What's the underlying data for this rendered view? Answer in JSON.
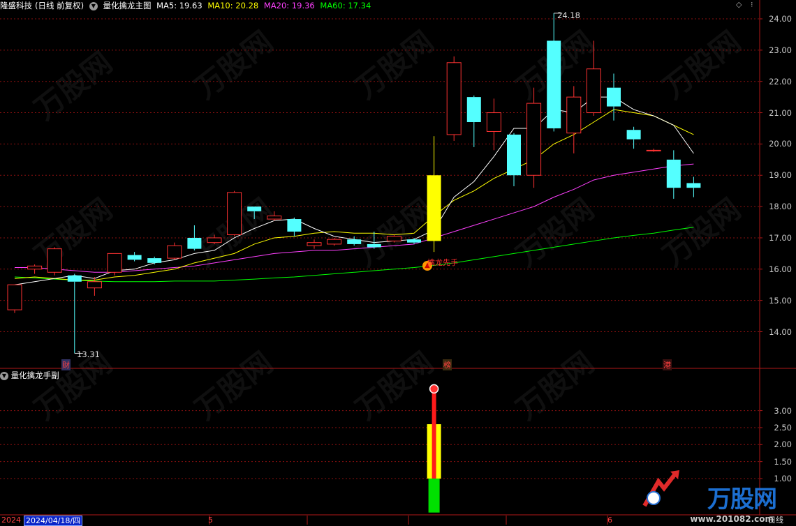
{
  "title_bar": {
    "stock_name": "隆盛科技",
    "period": "(日线 前复权)",
    "indicator_name": "量化擒龙主图",
    "ma5": "MA5: 19.63",
    "ma10": "MA10: 20.28",
    "ma20": "MA20: 19.36",
    "ma60": "MA60: 17.34",
    "colors": {
      "ma5": "#ffffff",
      "ma10": "#ffff00",
      "ma20": "#ff40ff",
      "ma60": "#00ff00"
    }
  },
  "sub_panel": {
    "title": "量化擒龙手副"
  },
  "main_axis": {
    "labels": [
      "24.00",
      "23.00",
      "22.00",
      "21.00",
      "20.00",
      "19.00",
      "18.00",
      "17.00",
      "16.00",
      "15.00",
      "14.00"
    ]
  },
  "sub_axis": {
    "labels": [
      "3.00",
      "2.50",
      "2.00",
      "1.50",
      "1.00"
    ]
  },
  "annotations": {
    "high": "24.18",
    "low": "13.31",
    "signal": "擒龙先手",
    "mark_cai": "财",
    "mark_bang": "榜",
    "mark_gang": "港"
  },
  "date_bar": {
    "start": "2024",
    "selected_date": "2024/04/18/四",
    "month5": "5",
    "month6": "6",
    "period_label": "日线"
  },
  "watermark": {
    "text": "万股网",
    "url": "www.201082.com"
  },
  "logo": {
    "text": "万股网",
    "url": "www.201082.com"
  },
  "chart_data": {
    "type": "candlestick",
    "ylim": [
      13.0,
      24.5
    ],
    "candles": [
      {
        "o": 14.7,
        "h": 15.5,
        "l": 14.6,
        "c": 15.5
      },
      {
        "o": 16.0,
        "h": 16.15,
        "l": 15.85,
        "c": 16.1
      },
      {
        "o": 15.9,
        "h": 16.7,
        "l": 15.8,
        "c": 16.65
      },
      {
        "o": 15.8,
        "h": 15.85,
        "l": 13.31,
        "c": 15.6
      },
      {
        "o": 15.4,
        "h": 15.75,
        "l": 15.15,
        "c": 15.6
      },
      {
        "o": 15.9,
        "h": 16.5,
        "l": 15.8,
        "c": 16.5
      },
      {
        "o": 16.45,
        "h": 16.55,
        "l": 16.25,
        "c": 16.3
      },
      {
        "o": 16.35,
        "h": 16.4,
        "l": 16.15,
        "c": 16.2
      },
      {
        "o": 16.35,
        "h": 16.85,
        "l": 16.3,
        "c": 16.75
      },
      {
        "o": 17.0,
        "h": 17.4,
        "l": 16.6,
        "c": 16.65
      },
      {
        "o": 16.85,
        "h": 17.1,
        "l": 16.8,
        "c": 17.0
      },
      {
        "o": 17.1,
        "h": 18.5,
        "l": 17.05,
        "c": 18.45
      },
      {
        "o": 18.0,
        "h": 18.0,
        "l": 17.6,
        "c": 17.85
      },
      {
        "o": 17.6,
        "h": 17.85,
        "l": 17.55,
        "c": 17.7
      },
      {
        "o": 17.6,
        "h": 17.65,
        "l": 17.05,
        "c": 17.2
      },
      {
        "o": 16.75,
        "h": 16.95,
        "l": 16.65,
        "c": 16.85
      },
      {
        "o": 16.8,
        "h": 17.0,
        "l": 16.75,
        "c": 16.95
      },
      {
        "o": 16.95,
        "h": 17.05,
        "l": 16.75,
        "c": 16.8
      },
      {
        "o": 16.8,
        "h": 17.2,
        "l": 16.65,
        "c": 16.7
      },
      {
        "o": 16.9,
        "h": 17.1,
        "l": 16.85,
        "c": 17.05
      },
      {
        "o": 16.95,
        "h": 17.0,
        "l": 16.8,
        "c": 16.85
      },
      {
        "o": 16.9,
        "h": 20.25,
        "l": 16.55,
        "c": 19.0
      },
      {
        "o": 20.3,
        "h": 22.8,
        "l": 20.1,
        "c": 22.6
      },
      {
        "o": 21.5,
        "h": 21.55,
        "l": 19.9,
        "c": 20.7
      },
      {
        "o": 20.4,
        "h": 21.45,
        "l": 19.8,
        "c": 21.0
      },
      {
        "o": 20.3,
        "h": 20.35,
        "l": 18.65,
        "c": 19.0
      },
      {
        "o": 19.0,
        "h": 21.8,
        "l": 18.6,
        "c": 21.3
      },
      {
        "o": 23.3,
        "h": 24.18,
        "l": 20.4,
        "c": 20.5
      },
      {
        "o": 20.35,
        "h": 21.85,
        "l": 19.7,
        "c": 21.5
      },
      {
        "o": 21.0,
        "h": 23.3,
        "l": 20.9,
        "c": 22.4
      },
      {
        "o": 21.8,
        "h": 22.25,
        "l": 20.75,
        "c": 21.2
      },
      {
        "o": 20.45,
        "h": 20.55,
        "l": 19.85,
        "c": 20.15
      },
      {
        "o": 19.8,
        "h": 19.85,
        "l": 19.75,
        "c": 19.8
      },
      {
        "o": 19.5,
        "h": 19.8,
        "l": 18.25,
        "c": 18.6
      },
      {
        "o": 18.75,
        "h": 18.95,
        "l": 18.3,
        "c": 18.6
      }
    ],
    "ma5": [
      15.5,
      15.6,
      15.7,
      15.8,
      15.7,
      15.95,
      16.0,
      16.2,
      16.3,
      16.5,
      16.6,
      17.0,
      17.3,
      17.55,
      17.6,
      17.3,
      17.05,
      16.95,
      16.85,
      16.9,
      16.95,
      17.25,
      18.3,
      18.8,
      19.6,
      20.5,
      20.5,
      21.1,
      21.0,
      21.5,
      21.5,
      21.1,
      20.9,
      20.6,
      19.7
    ],
    "ma10": [
      15.7,
      15.75,
      15.7,
      15.65,
      15.65,
      15.75,
      15.8,
      15.9,
      16.0,
      16.2,
      16.35,
      16.5,
      16.8,
      17.0,
      17.05,
      17.15,
      17.2,
      17.15,
      17.15,
      17.1,
      17.15,
      17.7,
      18.2,
      18.5,
      18.9,
      19.2,
      19.5,
      20.0,
      20.3,
      20.7,
      21.1,
      21.0,
      20.9,
      20.6,
      20.3
    ],
    "ma20": [
      16.05,
      16.05,
      16.0,
      15.95,
      15.9,
      15.9,
      15.95,
      16.0,
      16.05,
      16.1,
      16.2,
      16.3,
      16.4,
      16.5,
      16.55,
      16.6,
      16.6,
      16.65,
      16.7,
      16.75,
      16.8,
      17.0,
      17.2,
      17.4,
      17.6,
      17.8,
      18.0,
      18.3,
      18.55,
      18.85,
      19.0,
      19.1,
      19.2,
      19.3,
      19.36
    ],
    "ma60": [
      15.75,
      15.72,
      15.68,
      15.65,
      15.62,
      15.6,
      15.6,
      15.6,
      15.62,
      15.62,
      15.62,
      15.65,
      15.68,
      15.72,
      15.75,
      15.8,
      15.85,
      15.9,
      15.95,
      16.0,
      16.05,
      16.12,
      16.2,
      16.3,
      16.4,
      16.5,
      16.6,
      16.7,
      16.8,
      16.9,
      17.0,
      17.08,
      17.15,
      17.25,
      17.34
    ],
    "sub_signal": {
      "index": 21,
      "green": [
        0,
        1.0
      ],
      "yellow": [
        1.0,
        2.6
      ],
      "red": [
        1.0,
        3.6
      ]
    }
  }
}
